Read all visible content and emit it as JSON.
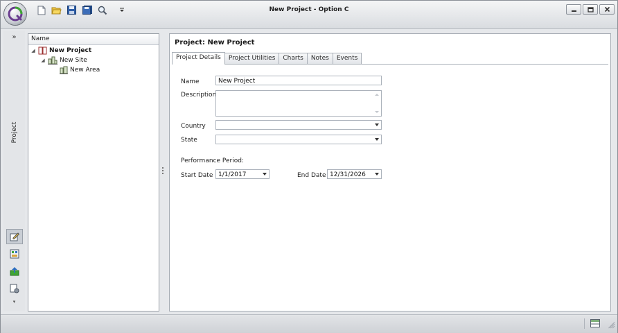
{
  "window": {
    "title": "New Project - Option C",
    "buttons": {
      "minimize": "minimize-icon",
      "maximize": "maximize-icon",
      "close": "close-icon"
    }
  },
  "quick_access": [
    {
      "name": "new-file-icon"
    },
    {
      "name": "open-folder-icon"
    },
    {
      "name": "save-icon"
    },
    {
      "name": "save-all-icon"
    },
    {
      "name": "search-icon"
    },
    {
      "name": "customize-dropdown-icon"
    }
  ],
  "nav": {
    "expand_label": "»",
    "panel_label": "Project",
    "icons": [
      "edit-icon",
      "dashboard-icon",
      "export-icon",
      "settings-icon"
    ],
    "more_label": "▾"
  },
  "tree": {
    "header": "Name",
    "nodes": [
      {
        "label": "New Project",
        "level": 0,
        "bold": true,
        "icon": "project-book-icon"
      },
      {
        "label": "New Site",
        "level": 1,
        "bold": false,
        "icon": "site-building-icon"
      },
      {
        "label": "New Area",
        "level": 2,
        "bold": false,
        "icon": "area-building-icon"
      }
    ]
  },
  "content": {
    "page_title": "Project: New Project",
    "tabs": [
      "Project Details",
      "Project Utilities",
      "Charts",
      "Notes",
      "Events"
    ],
    "active_tab": "Project Details",
    "form": {
      "name_label": "Name",
      "name_value": "New Project",
      "description_label": "Description",
      "description_value": "",
      "country_label": "Country",
      "country_value": "",
      "state_label": "State",
      "state_value": "",
      "period_label": "Performance Period:",
      "start_label": "Start Date",
      "start_value": "1/1/2017",
      "end_label": "End Date",
      "end_value": "12/31/2026"
    }
  },
  "colors": {
    "accent_logo_green": "#3fa535",
    "accent_logo_purple": "#6a3d8f",
    "chrome_bg": "#e6e8eb"
  }
}
